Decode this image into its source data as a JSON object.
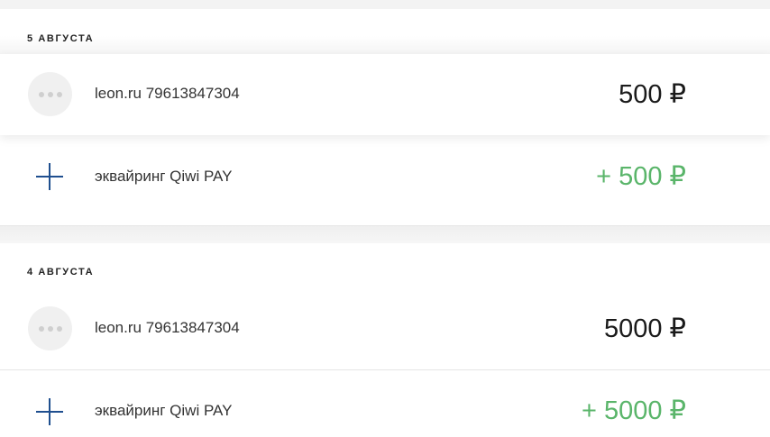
{
  "colors": {
    "income_green": "#5ab56a",
    "plus_icon_blue": "#1f4f8f",
    "text_dark": "#1a1a1a"
  },
  "groups": [
    {
      "date": "5 АВГУСТА",
      "items": [
        {
          "icon": "more-dots-icon",
          "description": "leon.ru 79613847304",
          "amount": "500 ₽"
        },
        {
          "icon": "plus-icon",
          "description": "эквайринг Qiwi PAY",
          "amount": "+ 500 ₽"
        }
      ]
    },
    {
      "date": "4 АВГУСТА",
      "items": [
        {
          "icon": "more-dots-icon",
          "description": "leon.ru 79613847304",
          "amount": "5000 ₽"
        },
        {
          "icon": "plus-icon",
          "description": "эквайринг Qiwi PAY",
          "amount": "+ 5000 ₽"
        }
      ]
    }
  ]
}
